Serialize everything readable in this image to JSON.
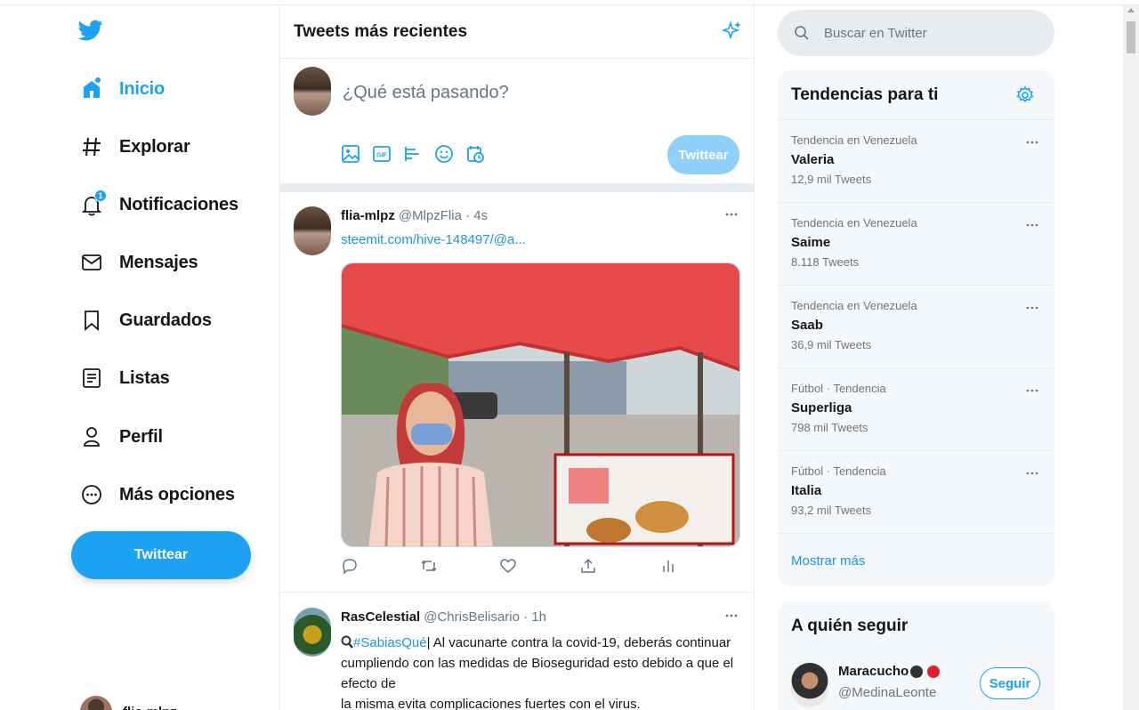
{
  "nav": {
    "items": [
      {
        "label": "Inicio",
        "icon": "home-icon",
        "active": true
      },
      {
        "label": "Explorar",
        "icon": "hashtag-icon"
      },
      {
        "label": "Notificaciones",
        "icon": "bell-icon",
        "badge": "1"
      },
      {
        "label": "Mensajes",
        "icon": "envelope-icon"
      },
      {
        "label": "Guardados",
        "icon": "bookmark-icon"
      },
      {
        "label": "Listas",
        "icon": "list-icon"
      },
      {
        "label": "Perfil",
        "icon": "person-icon"
      },
      {
        "label": "Más opciones",
        "icon": "more-circle-icon"
      }
    ],
    "tweet_button": "Twittear",
    "account_name": "flia-mlpz"
  },
  "center": {
    "title": "Tweets más recientes",
    "composer": {
      "placeholder": "¿Qué está pasando?",
      "submit": "Twittear"
    },
    "tweets": [
      {
        "name": "flia-mlpz",
        "handle": "@MlpzFlia · 4s",
        "link": "steemit.com/hive-148497/@a..."
      },
      {
        "name": "RasCelestial",
        "handle": "@ChrisBelisario · 1h",
        "hashtag": "#SabiasQué",
        "text_line1": "| Al vacunarte contra la covid-19, deberás continuar",
        "text_line2": "cumpliendo con las medidas de Bioseguridad esto debido a que el efecto de",
        "text_line3": "la misma evita complicaciones fuertes con el virus."
      }
    ]
  },
  "right": {
    "search_placeholder": "Buscar en Twitter",
    "trends_title": "Tendencias para ti",
    "trends": [
      {
        "context": "Tendencia en Venezuela",
        "name": "Valeria",
        "count": "12,9 mil Tweets"
      },
      {
        "context": "Tendencia en Venezuela",
        "name": "Saime",
        "count": "8.118 Tweets"
      },
      {
        "context": "Tendencia en Venezuela",
        "name": "Saab",
        "count": "36,9 mil Tweets"
      },
      {
        "context": "Fútbol · Tendencia",
        "name": "Superliga",
        "count": "798 mil Tweets"
      },
      {
        "context": "Fútbol · Tendencia",
        "name": "Italia",
        "count": "93,2 mil Tweets"
      }
    ],
    "show_more": "Mostrar más",
    "follow_title": "A quién seguir",
    "follow": {
      "name": "Maracucho",
      "handle": "@MedinaLeonte",
      "button": "Seguir"
    }
  },
  "colors": {
    "accent": "#1da1f2",
    "text": "#14171a",
    "muted": "#657786",
    "panel": "#f5f8fa"
  }
}
